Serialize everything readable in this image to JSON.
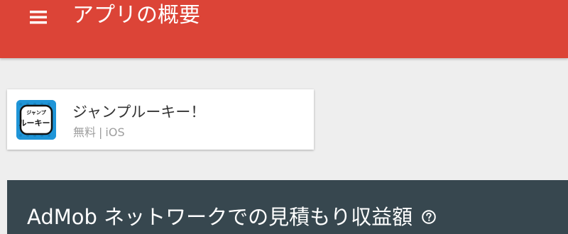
{
  "header": {
    "title": "アプリの概要",
    "background_color": "#dc4437",
    "menu_icon": "menu-icon"
  },
  "app_card": {
    "name": "ジャンプルーキー！",
    "price": "無料",
    "separator": "|",
    "platform": "iOS",
    "icon": "app-icon",
    "icon_text_top": "ジャンプ",
    "icon_text_main": "ルーキー!"
  },
  "earnings": {
    "title": "AdMob ネットワークでの見積もり収益額",
    "help_icon": "help-circle-icon",
    "background_color": "#37474f"
  }
}
